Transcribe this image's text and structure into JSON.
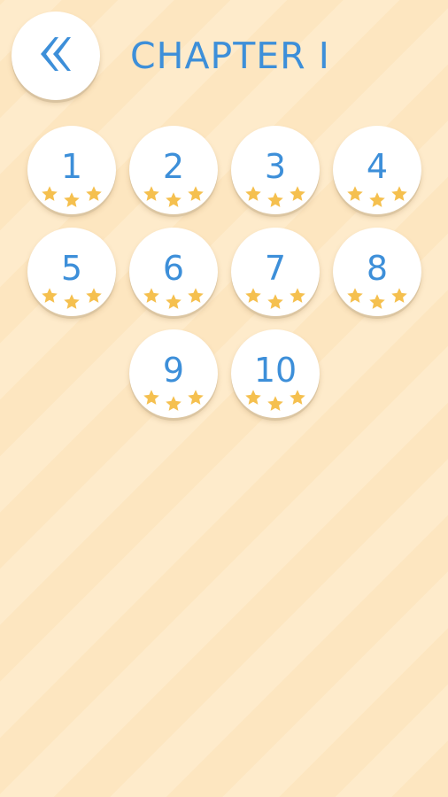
{
  "header": {
    "title": "CHAPTER I",
    "back_icon": "double-chevron-left-icon"
  },
  "colors": {
    "accent": "#3d8fd9",
    "star": "#f5c04f",
    "background": "#fde8c4"
  },
  "levels": [
    {
      "number": "1",
      "stars": 3
    },
    {
      "number": "2",
      "stars": 3
    },
    {
      "number": "3",
      "stars": 3
    },
    {
      "number": "4",
      "stars": 3
    },
    {
      "number": "5",
      "stars": 3
    },
    {
      "number": "6",
      "stars": 3
    },
    {
      "number": "7",
      "stars": 3
    },
    {
      "number": "8",
      "stars": 3
    },
    {
      "number": "9",
      "stars": 3
    },
    {
      "number": "10",
      "stars": 3
    }
  ]
}
